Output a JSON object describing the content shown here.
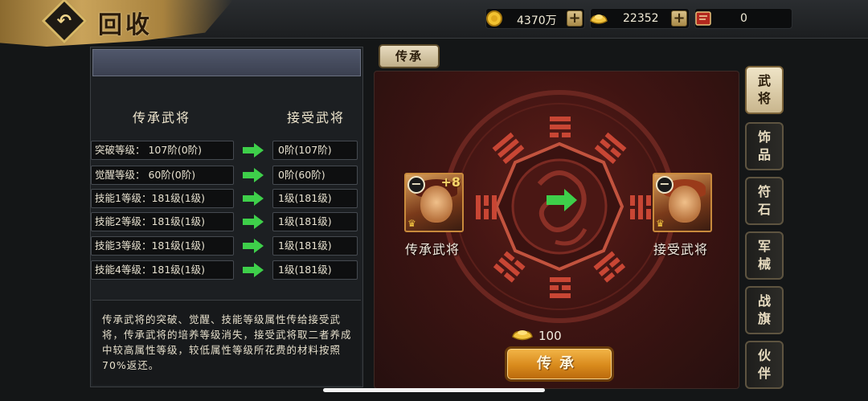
{
  "header": {
    "title": "回收",
    "resources": [
      {
        "icon": "gold-coin-icon",
        "value": "4370万"
      },
      {
        "icon": "gold-ingot-icon",
        "value": "22352"
      },
      {
        "icon": "scroll-icon",
        "value": "0"
      }
    ]
  },
  "left": {
    "col_left": "传承武将",
    "col_right": "接受武将",
    "rows": [
      {
        "left": "突破等级： 107阶(0阶)",
        "right": "0阶(107阶)"
      },
      {
        "left": "觉醒等级： 60阶(0阶)",
        "right": "0阶(60阶)"
      },
      {
        "left": "技能1等级：181级(1级)",
        "right": "1级(181级)"
      },
      {
        "left": "技能2等级：181级(1级)",
        "right": "1级(181级)"
      },
      {
        "left": "技能3等级：181级(1级)",
        "right": "1级(181级)"
      },
      {
        "left": "技能4等级：181级(1级)",
        "right": "1级(181级)"
      }
    ],
    "description": "传承武将的突破、觉醒、技能等级属性传给接受武将，传承武将的培养等级消失，接受武将取二者养成中较高属性等级，较低属性等级所花费的材料按照70%返还。"
  },
  "center": {
    "tab": "传承",
    "source_label": "传承武将",
    "source_plus": "+8",
    "target_label": "接受武将",
    "cost": "100",
    "button": "传承"
  },
  "side_tabs": [
    "武将",
    "饰品",
    "符石",
    "军械",
    "战旗",
    "伙伴"
  ],
  "colors": {
    "accent": "#e39a2a",
    "green_arrow": "#3ecf4a",
    "stage_red": "#4a1614"
  }
}
